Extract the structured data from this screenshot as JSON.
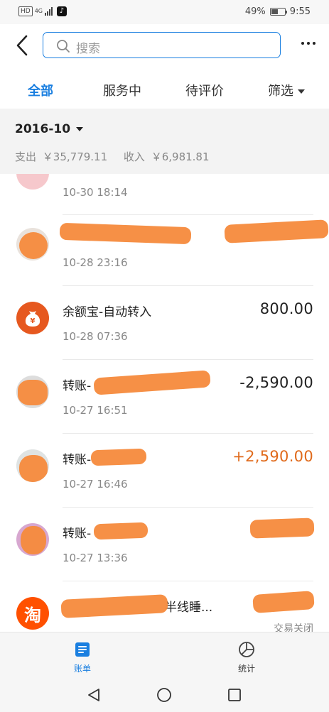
{
  "status_bar": {
    "hd": "HD",
    "network": "4G",
    "battery_percent": "49%",
    "battery_level": 0.49,
    "time": "9:55"
  },
  "header": {
    "search_placeholder": "搜索",
    "back_icon": "chevron-left-icon",
    "more_icon": "more-dots-icon"
  },
  "tabs": [
    {
      "label": "全部",
      "active": true
    },
    {
      "label": "服务中",
      "active": false
    },
    {
      "label": "待评价",
      "active": false
    },
    {
      "label": "筛选",
      "active": false
    }
  ],
  "summary": {
    "month": "2016-10",
    "expense_label": "支出",
    "expense_value": "￥35,779.11",
    "income_label": "收入",
    "income_value": "￥6,981.81"
  },
  "transactions": [
    {
      "title": "",
      "time": "10-30  18:14",
      "amount": "",
      "status": ""
    },
    {
      "title": "",
      "time": "10-28  23:16",
      "amount": "",
      "status": ""
    },
    {
      "title": "余额宝-自动转入",
      "time": "10-28  07:36",
      "amount": "800.00",
      "status": ""
    },
    {
      "title": "转账-",
      "time": "10-27  16:51",
      "amount": "-2,590.00",
      "status": ""
    },
    {
      "title": "转账-",
      "time": "10-27  16:46",
      "amount": "+2,590.00",
      "status": ""
    },
    {
      "title": "转账-",
      "time": "10-27  13:36",
      "amount": "",
      "status": ""
    },
    {
      "title": "半线睡...",
      "time": "",
      "amount": "",
      "status": "交易关闭"
    }
  ],
  "bottom_tabs": [
    {
      "label": "账单",
      "active": true
    },
    {
      "label": "统计",
      "active": false
    }
  ],
  "colors": {
    "accent": "#1a7fe0",
    "positive_amount": "#e06a1b",
    "yuebao_orange": "#e6581f",
    "taobao_orange": "#ff5000",
    "redaction": "#f58a3c"
  }
}
